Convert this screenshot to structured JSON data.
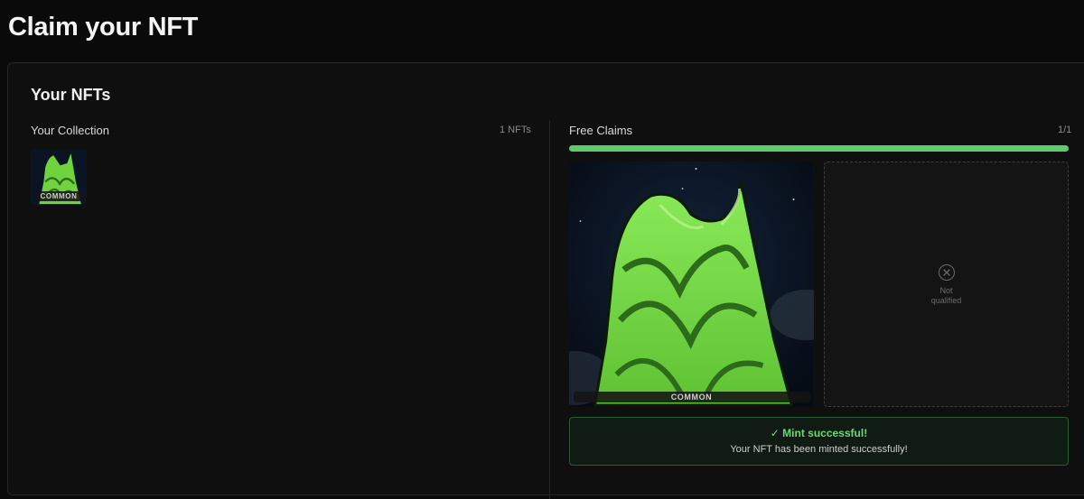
{
  "page": {
    "title": "Claim your NFT"
  },
  "section": {
    "title": "Your NFTs"
  },
  "collection": {
    "label": "Your Collection",
    "count": "1 NFTs",
    "items": [
      {
        "rarity": "COMMON"
      }
    ]
  },
  "claims": {
    "label": "Free Claims",
    "count": "1/1",
    "progress": 1.0,
    "cards": [
      {
        "rarity": "COMMON",
        "status": "claimed"
      },
      {
        "status": "Not\nqualified",
        "icon": "x-circle-icon"
      }
    ]
  },
  "alert": {
    "title": "✓ Mint successful!",
    "message": "Your NFT has been minted successfully!"
  },
  "colors": {
    "background": "#0a0a0a",
    "accent": "#5ecb6b",
    "cloth": "#7ee04d",
    "success_border": "#2a5a33"
  }
}
